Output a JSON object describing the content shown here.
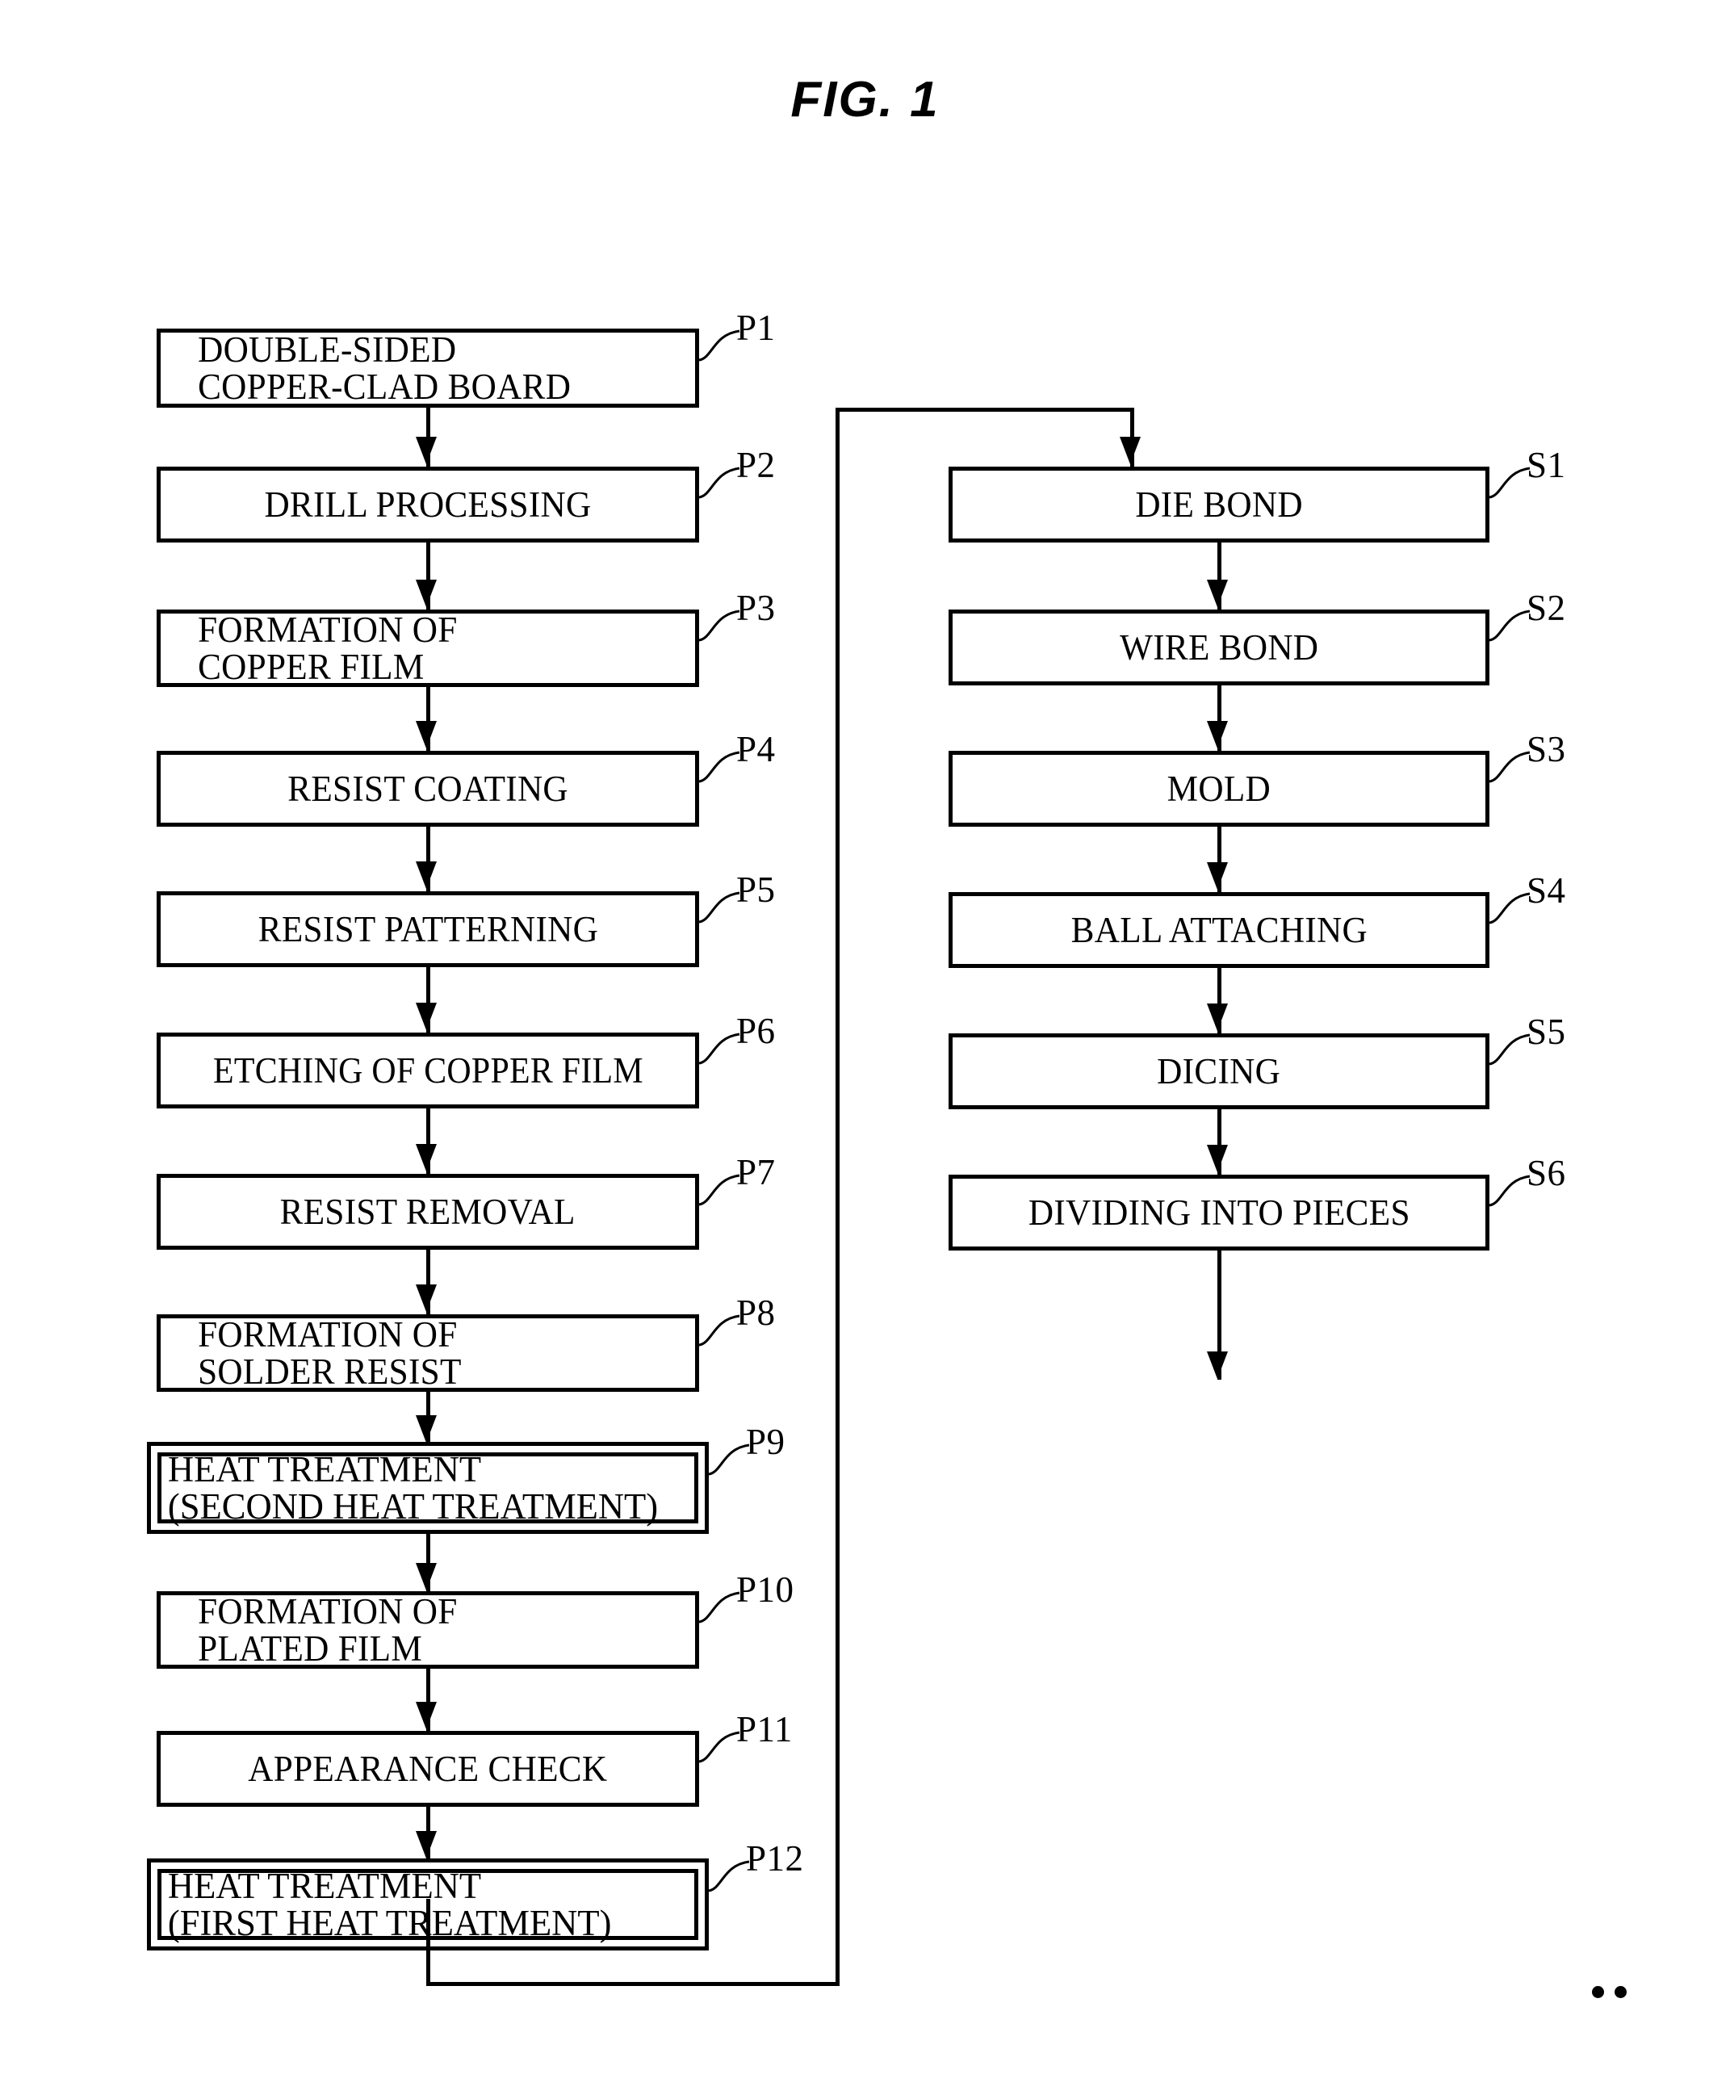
{
  "figure": {
    "title": "FIG. 1",
    "type": "process-flowchart"
  },
  "left_column": {
    "steps": [
      {
        "ref": "P1",
        "text": "DOUBLE-SIDED\nCOPPER-CLAD BOARD",
        "lines": 2,
        "framed": "double-line",
        "align": "left"
      },
      {
        "ref": "P2",
        "text": "DRILL PROCESSING",
        "lines": 1,
        "framed": "single",
        "align": "center"
      },
      {
        "ref": "P3",
        "text": "FORMATION OF\nCOPPER FILM",
        "lines": 2,
        "framed": "single",
        "align": "left"
      },
      {
        "ref": "P4",
        "text": "RESIST COATING",
        "lines": 1,
        "framed": "single",
        "align": "center"
      },
      {
        "ref": "P5",
        "text": "RESIST PATTERNING",
        "lines": 1,
        "framed": "single",
        "align": "center"
      },
      {
        "ref": "P6",
        "text": "ETCHING OF COPPER FILM",
        "lines": 1,
        "framed": "single",
        "align": "center"
      },
      {
        "ref": "P7",
        "text": "RESIST REMOVAL",
        "lines": 1,
        "framed": "single",
        "align": "center"
      },
      {
        "ref": "P8",
        "text": "FORMATION OF\nSOLDER RESIST",
        "lines": 2,
        "framed": "single",
        "align": "left"
      },
      {
        "ref": "P9",
        "text": "HEAT TREATMENT\n(SECOND HEAT TREATMENT)",
        "lines": 2,
        "framed": "double",
        "align": "left"
      },
      {
        "ref": "P10",
        "text": "FORMATION OF\nPLATED FILM",
        "lines": 2,
        "framed": "single",
        "align": "left"
      },
      {
        "ref": "P11",
        "text": "APPEARANCE CHECK",
        "lines": 1,
        "framed": "single",
        "align": "center"
      },
      {
        "ref": "P12",
        "text": "HEAT TREATMENT\n(FIRST HEAT TREATMENT)",
        "lines": 2,
        "framed": "double",
        "align": "left"
      }
    ]
  },
  "right_column": {
    "steps": [
      {
        "ref": "S1",
        "text": "DIE BOND",
        "align": "center"
      },
      {
        "ref": "S2",
        "text": "WIRE BOND",
        "align": "center"
      },
      {
        "ref": "S3",
        "text": "MOLD",
        "align": "center"
      },
      {
        "ref": "S4",
        "text": "BALL ATTACHING",
        "align": "center"
      },
      {
        "ref": "S5",
        "text": "DICING",
        "align": "center"
      },
      {
        "ref": "S6",
        "text": "DIVIDING INTO PIECES",
        "align": "center"
      }
    ]
  },
  "connectors": {
    "loop_note": "P12 bottom routes down, right, up and into S1 (DIE BOND)",
    "terminal_note": "S6 exits downward with an open arrow"
  },
  "colors": {
    "stroke": "#000000",
    "background": "#ffffff",
    "text": "#000000"
  }
}
